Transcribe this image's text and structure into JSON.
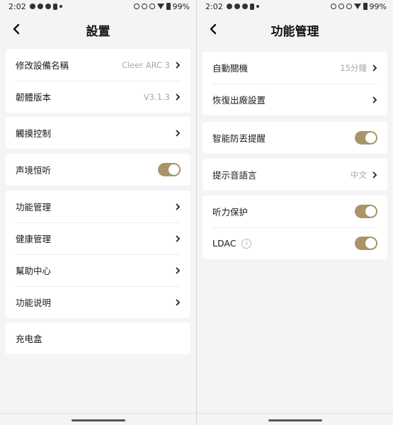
{
  "left": {
    "status": {
      "time": "2:02",
      "battery": "99%"
    },
    "title": "設置",
    "cards": [
      {
        "rows": [
          {
            "label": "修改設備名稱",
            "value": "Cleer ARC 3",
            "control": "chevron"
          },
          {
            "label": "韌體版本",
            "value": "V3.1.3",
            "control": "chevron"
          }
        ]
      },
      {
        "rows": [
          {
            "label": "觸摸控制",
            "value": "",
            "control": "chevron"
          }
        ]
      },
      {
        "rows": [
          {
            "label": "声境恒听",
            "value": "",
            "control": "toggle",
            "state": "on"
          }
        ]
      },
      {
        "rows": [
          {
            "label": "功能管理",
            "value": "",
            "control": "chevron"
          },
          {
            "label": "健康管理",
            "value": "",
            "control": "chevron"
          },
          {
            "label": "幫助中心",
            "value": "",
            "control": "chevron"
          },
          {
            "label": "功能说明",
            "value": "",
            "control": "chevron"
          }
        ]
      },
      {
        "rows": [
          {
            "label": "充电盒",
            "value": "",
            "control": "none"
          }
        ]
      }
    ]
  },
  "right": {
    "status": {
      "time": "2:02",
      "battery": "99%"
    },
    "title": "功能管理",
    "cards": [
      {
        "rows": [
          {
            "label": "自動關機",
            "value": "15分鐘",
            "control": "chevron"
          },
          {
            "label": "恢復出廠設置",
            "value": "",
            "control": "chevron"
          }
        ]
      },
      {
        "rows": [
          {
            "label": "智能防丟提醒",
            "value": "",
            "control": "toggle",
            "state": "on"
          }
        ]
      },
      {
        "rows": [
          {
            "label": "提示音語言",
            "value": "中文",
            "control": "chevron"
          }
        ]
      },
      {
        "rows": [
          {
            "label": "听力保护",
            "value": "",
            "control": "toggle",
            "state": "on"
          },
          {
            "label": "LDAC",
            "value": "",
            "control": "toggle",
            "state": "on",
            "info_icon": "info-icon"
          }
        ]
      }
    ]
  },
  "colors": {
    "accent": "#a89467",
    "background": "#f4f4f4",
    "card": "#ffffff"
  }
}
